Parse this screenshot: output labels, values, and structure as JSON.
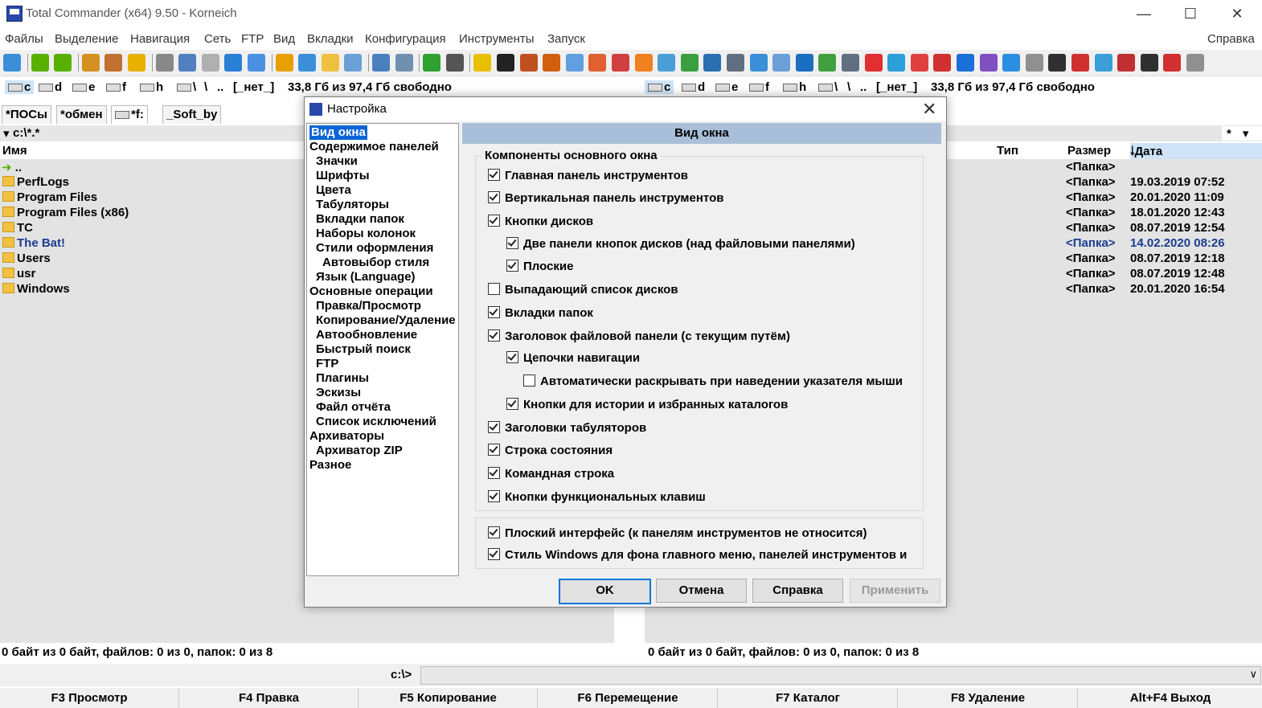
{
  "window": {
    "title": "Total Commander (x64) 9.50 - Korneich"
  },
  "menu": [
    "Файлы",
    "Выделение",
    "Навигация",
    "Сеть",
    "FTP",
    "Вид",
    "Вкладки",
    "Конфигурация",
    "Инструменты",
    "Запуск"
  ],
  "menu_help": "Справка",
  "left_drives": {
    "c": "c",
    "d": "d",
    "e": "e",
    "f": "f",
    "h": "h",
    "root": "\\",
    "back": "\\",
    "up": "..",
    "label": "[_нет_]",
    "free": "33,8 Гб из 97,4 Гб свободно"
  },
  "right_drives": {
    "c": "c",
    "d": "d",
    "e": "e",
    "f": "f",
    "h": "h",
    "root": "\\",
    "back": "\\",
    "up": "..",
    "label": "[_нет_]",
    "free": "33,8 Гб из 97,4 Гб свободно"
  },
  "tabs": [
    "*ПОСы",
    "*обмен",
    "*f:",
    "_Soft_by"
  ],
  "left_path": "c:\\*.*",
  "right_filter": "*",
  "left_panel": {
    "col_name": "Имя",
    "items": [
      "..",
      "PerfLogs",
      "Program Files",
      "Program Files (x86)",
      "TC",
      "The Bat!",
      "Users",
      "usr",
      "Windows"
    ]
  },
  "right_panel": {
    "col_type": "Тип",
    "col_size": "Размер",
    "col_date": "Дата",
    "rows": [
      {
        "size": "<Папка>",
        "date": ""
      },
      {
        "size": "<Папка>",
        "date": "19.03.2019 07:52"
      },
      {
        "size": "<Папка>",
        "date": "20.01.2020 11:09"
      },
      {
        "size": "<Папка>",
        "date": "18.01.2020 12:43"
      },
      {
        "size": "<Папка>",
        "date": "08.07.2019 12:54"
      },
      {
        "size": "<Папка>",
        "date": "14.02.2020 08:26"
      },
      {
        "size": "<Папка>",
        "date": "08.07.2019 12:18"
      },
      {
        "size": "<Папка>",
        "date": "08.07.2019 12:48"
      },
      {
        "size": "<Папка>",
        "date": "20.01.2020 16:54"
      }
    ]
  },
  "left_status": "0 байт из 0 байт, файлов: 0 из 0, папок: 0 из 8",
  "right_status": "0 байт из 0 байт, файлов: 0 из 0, папок: 0 из 8",
  "cmd_prompt": "c:\\>",
  "fkeys": [
    "F3 Просмотр",
    "F4 Правка",
    "F5 Копирование",
    "F6 Перемещение",
    "F7 Каталог",
    "F8 Удаление",
    "Alt+F4 Выход"
  ],
  "colors": {
    "accent": "#0a64d6",
    "section_header": "#a9bfd9",
    "highlight_text": "#1a3d8f",
    "panel_bg": "#e3e3e3"
  },
  "dialog": {
    "title": "Настройка",
    "tree": [
      "Вид окна",
      "Содержимое панелей",
      "Значки",
      "Шрифты",
      "Цвета",
      "Табуляторы",
      "Вкладки папок",
      "Наборы колонок",
      "Стили оформления",
      "Автовыбор стиля",
      "Язык (Language)",
      "Основные операции",
      "Правка/Просмотр",
      "Копирование/Удаление",
      "Автообновление",
      "Быстрый поиск",
      "FTP",
      "Плагины",
      "Эскизы",
      "Файл отчёта",
      "Список исключений",
      "Архиваторы",
      "Архиватор ZIP",
      "Разное"
    ],
    "section_title": "Вид окна",
    "group_label": "Компоненты основного окна",
    "options": [
      {
        "label": "Главная панель инструментов",
        "checked": true
      },
      {
        "label": "Вертикальная панель инструментов",
        "checked": true
      },
      {
        "label": "Кнопки дисков",
        "checked": true
      },
      {
        "label": "Две панели кнопок дисков (над файловыми панелями)",
        "checked": true
      },
      {
        "label": "Плоские",
        "checked": true
      },
      {
        "label": "Выпадающий список дисков",
        "checked": false
      },
      {
        "label": "Вкладки папок",
        "checked": true
      },
      {
        "label": "Заголовок файловой панели (с текущим путём)",
        "checked": true
      },
      {
        "label": "Цепочки навигации",
        "checked": true
      },
      {
        "label": "Автоматически раскрывать при наведении указателя мыши",
        "checked": false
      },
      {
        "label": "Кнопки для истории и избранных каталогов",
        "checked": true
      },
      {
        "label": "Заголовки табуляторов",
        "checked": true
      },
      {
        "label": "Строка состояния",
        "checked": true
      },
      {
        "label": "Командная строка",
        "checked": true
      },
      {
        "label": "Кнопки функциональных клавиш",
        "checked": true
      }
    ],
    "options2": [
      {
        "label": "Плоский интерфейс (к панелям инструментов не относится)",
        "checked": true
      },
      {
        "label": "Стиль Windows для фона главного меню, панелей инструментов и",
        "checked": true
      }
    ],
    "buttons": {
      "ok": "OK",
      "cancel": "Отмена",
      "help": "Справка",
      "apply": "Применить"
    }
  }
}
